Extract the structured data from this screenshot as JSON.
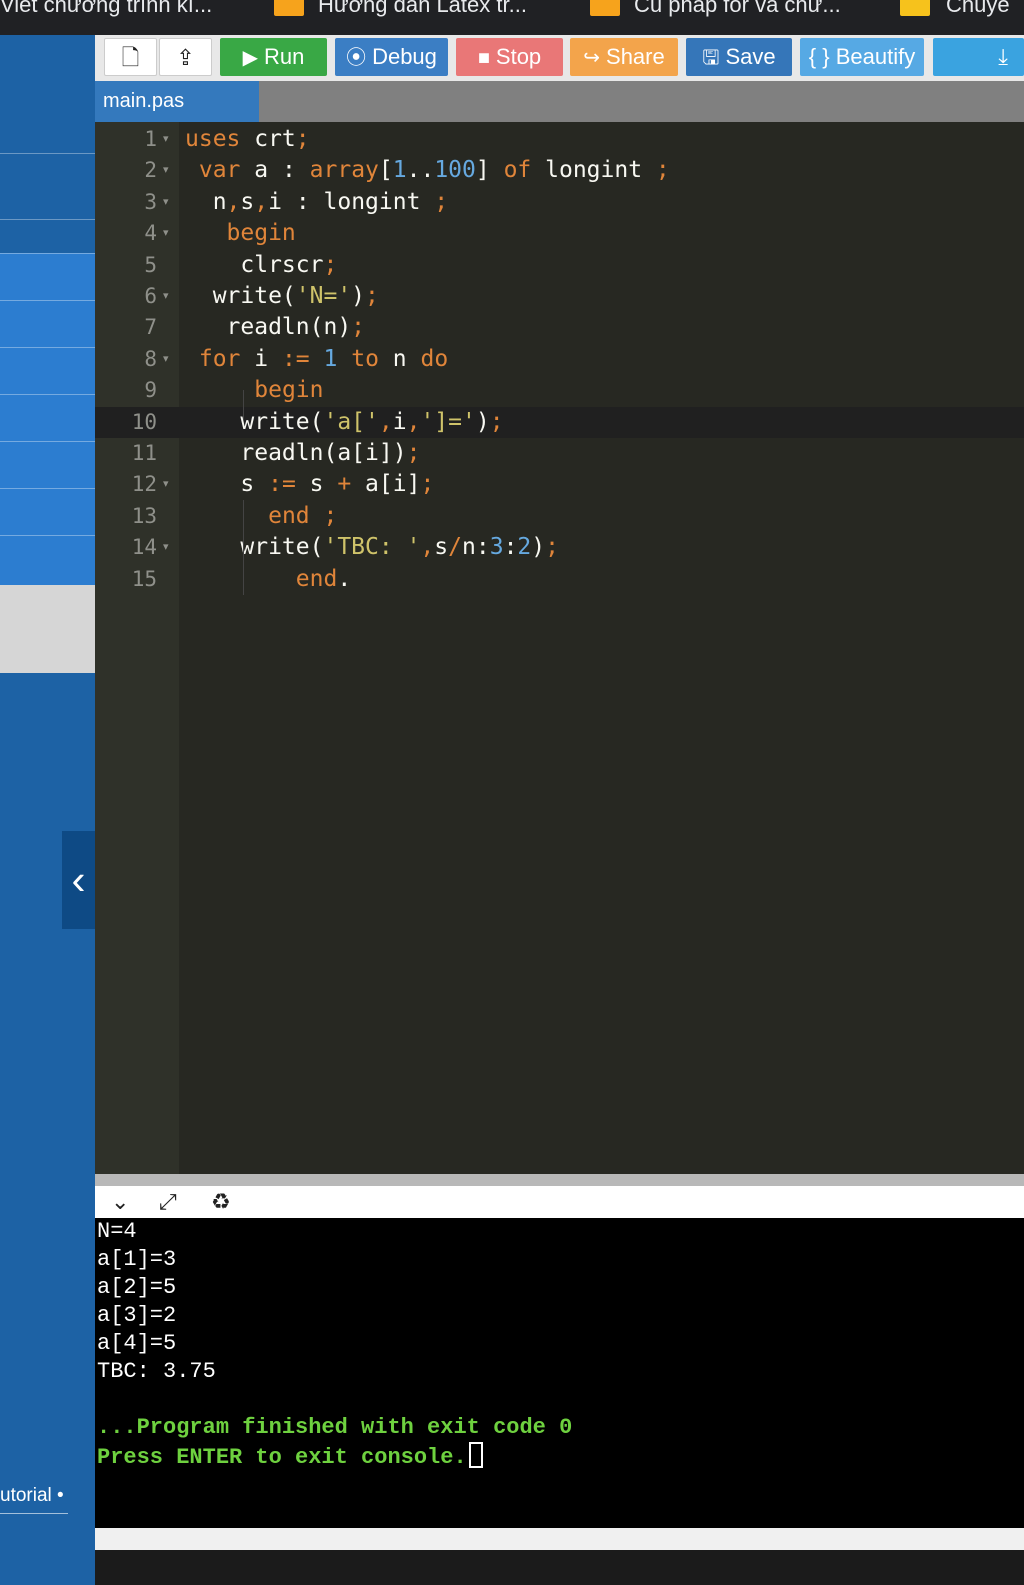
{
  "bookmarks": [
    {
      "label": "Viết chương trình kí...",
      "icon": "bookmark-icon",
      "color": ""
    },
    {
      "label": "Hướng dẫn Latex tr...",
      "icon": "hoc24-icon",
      "color": "#f6a31c"
    },
    {
      "label": "Cú pháp for và chứ...",
      "icon": "hoc24-icon",
      "color": "#f6a31c"
    },
    {
      "label": "Chuyê",
      "icon": "crown-icon",
      "color": "#f6c21c"
    }
  ],
  "toolbar": {
    "new_icon": "file-icon",
    "upload_icon": "upload-icon",
    "run": {
      "label": "Run",
      "icon": "play-icon",
      "color": "#39a845"
    },
    "debug": {
      "label": "Debug",
      "icon": "debug-icon",
      "color": "#3b7ec4"
    },
    "stop": {
      "label": "Stop",
      "icon": "stop-icon",
      "color": "#e97777"
    },
    "share": {
      "label": "Share",
      "icon": "share-icon",
      "color": "#f3a44b"
    },
    "save": {
      "label": "Save",
      "icon": "floppy-icon",
      "color": "#3576b9"
    },
    "beautify": {
      "label": "{ } Beautify",
      "color": "#56a9e4"
    },
    "download_icon": "download-icon",
    "download_color": "#3aa3e0"
  },
  "tabs": [
    {
      "label": "main.pas",
      "active": true
    }
  ],
  "editor": {
    "active_line": 10,
    "lines": [
      {
        "n": "1",
        "fold": true
      },
      {
        "n": "2",
        "fold": true
      },
      {
        "n": "3",
        "fold": true
      },
      {
        "n": "4",
        "fold": true
      },
      {
        "n": "5",
        "fold": false
      },
      {
        "n": "6",
        "fold": true
      },
      {
        "n": "7",
        "fold": false
      },
      {
        "n": "8",
        "fold": true
      },
      {
        "n": "9",
        "fold": false
      },
      {
        "n": "10",
        "fold": false
      },
      {
        "n": "11",
        "fold": false
      },
      {
        "n": "12",
        "fold": true
      },
      {
        "n": "13",
        "fold": false
      },
      {
        "n": "14",
        "fold": true
      },
      {
        "n": "15",
        "fold": false
      }
    ],
    "code": [
      [
        [
          "kw",
          "uses"
        ],
        [
          "",
          " crt"
        ],
        [
          "op",
          ";"
        ]
      ],
      [
        [
          "",
          " "
        ],
        [
          "kw",
          "var"
        ],
        [
          "",
          " a : "
        ],
        [
          "kw",
          "array"
        ],
        [
          "",
          "["
        ],
        [
          "nm",
          "1"
        ],
        [
          "",
          ".."
        ],
        [
          "nm",
          "100"
        ],
        [
          "",
          "] "
        ],
        [
          "kw",
          "of"
        ],
        [
          "",
          " longint "
        ],
        [
          "op",
          ";"
        ]
      ],
      [
        [
          "",
          "  n"
        ],
        [
          "op",
          ","
        ],
        [
          "",
          "s"
        ],
        [
          "op",
          ","
        ],
        [
          "",
          "i : longint "
        ],
        [
          "op",
          ";"
        ]
      ],
      [
        [
          "",
          "   "
        ],
        [
          "kw",
          "begin"
        ]
      ],
      [
        [
          "",
          "    clrscr"
        ],
        [
          "op",
          ";"
        ]
      ],
      [
        [
          "",
          "  write("
        ],
        [
          "st",
          "'N='"
        ],
        [
          "",
          ")"
        ],
        [
          "op",
          ";"
        ]
      ],
      [
        [
          "",
          "   readln(n)"
        ],
        [
          "op",
          ";"
        ]
      ],
      [
        [
          "",
          " "
        ],
        [
          "kw",
          "for"
        ],
        [
          "",
          " i "
        ],
        [
          "op",
          ":="
        ],
        [
          "",
          " "
        ],
        [
          "nm",
          "1"
        ],
        [
          "",
          " "
        ],
        [
          "kw",
          "to"
        ],
        [
          "",
          " n "
        ],
        [
          "kw",
          "do"
        ]
      ],
      [
        [
          "",
          "     "
        ],
        [
          "kw",
          "begin"
        ]
      ],
      [
        [
          "",
          "    write("
        ],
        [
          "st",
          "'a['"
        ],
        [
          "op",
          ","
        ],
        [
          "",
          "i"
        ],
        [
          "op",
          ","
        ],
        [
          "st",
          "']='"
        ],
        [
          "",
          ")"
        ],
        [
          "op",
          ";"
        ]
      ],
      [
        [
          "",
          "    readln(a[i])"
        ],
        [
          "op",
          ";"
        ]
      ],
      [
        [
          "",
          "    s "
        ],
        [
          "op",
          ":="
        ],
        [
          "",
          " s "
        ],
        [
          "op",
          "+"
        ],
        [
          "",
          " a[i]"
        ],
        [
          "op",
          ";"
        ]
      ],
      [
        [
          "",
          "      "
        ],
        [
          "kw",
          "end"
        ],
        [
          "",
          " "
        ],
        [
          "op",
          ";"
        ]
      ],
      [
        [
          "",
          "    write("
        ],
        [
          "st",
          "'TBC: '"
        ],
        [
          "op",
          ","
        ],
        [
          "",
          "s"
        ],
        [
          "op",
          "/"
        ],
        [
          "",
          "n:"
        ],
        [
          "nm",
          "3"
        ],
        [
          "",
          ":"
        ],
        [
          "nm",
          "2"
        ],
        [
          "",
          ")"
        ],
        [
          "op",
          ";"
        ]
      ],
      [
        [
          "",
          "        "
        ],
        [
          "kw",
          "end"
        ],
        [
          "",
          "."
        ]
      ]
    ]
  },
  "console_bar": {
    "collapse_icon": "chevron-down-icon",
    "expand_icon": "expand-icon",
    "clear_icon": "clear-console-icon"
  },
  "console": {
    "lines": [
      "N=4",
      "a[1]=3",
      "a[2]=5",
      "a[3]=2",
      "a[4]=5",
      "TBC: 3.75",
      ""
    ],
    "status_lines": [
      "...Program finished with exit code 0",
      "Press ENTER to exit console."
    ]
  },
  "sidebar": {
    "collapse_icon": "chevron-left-icon",
    "footer_label": "utorial •"
  }
}
